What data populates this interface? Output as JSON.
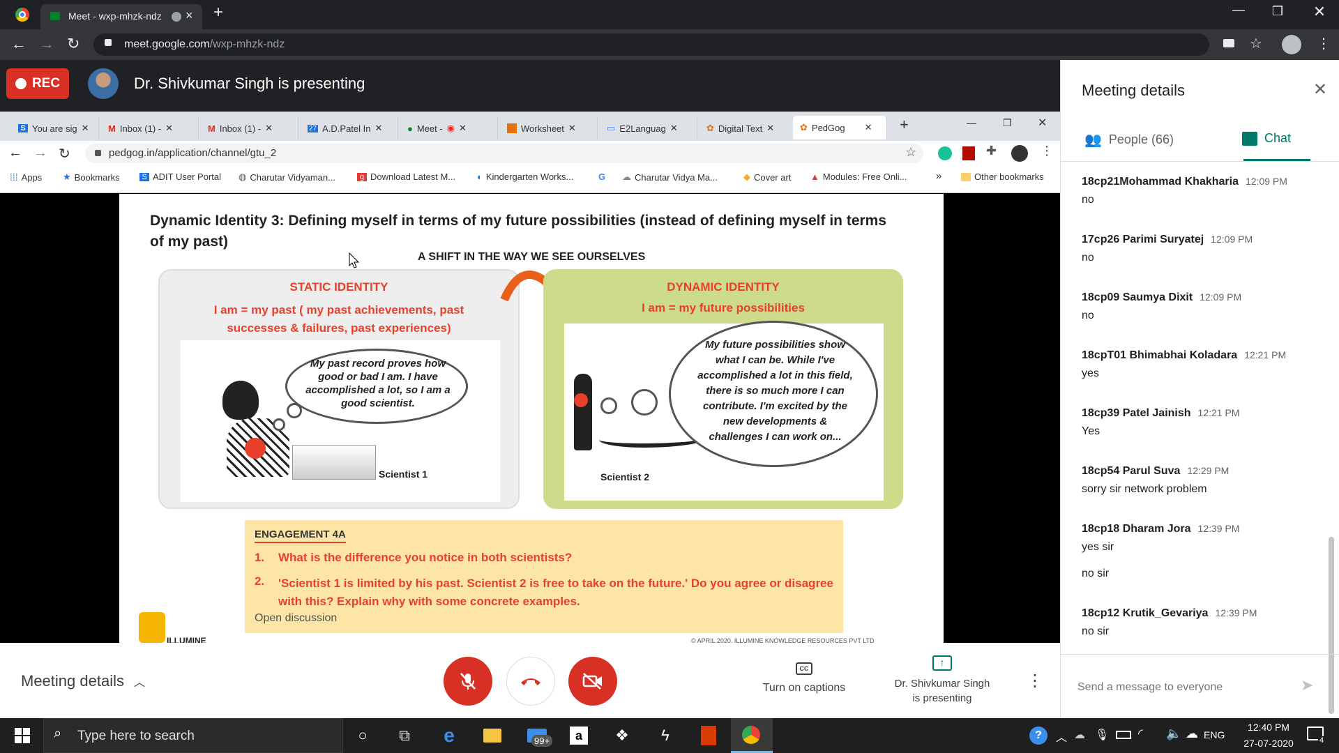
{
  "browser": {
    "tab_title": "Meet - wxp-mhzk-ndz",
    "url_host": "meet.google.com",
    "url_path": "/wxp-mhzk-ndz"
  },
  "meet": {
    "rec_label": "REC",
    "presenting_banner": "Dr. Shivkumar Singh is presenting"
  },
  "inner_browser": {
    "tabs": [
      "You are sig",
      "Inbox (1) -",
      "Inbox (1) -",
      "A.D.Patel In",
      "Meet -",
      "Worksheet",
      "E2Languag",
      "Digital Text",
      "PedGog"
    ],
    "url": "pedgog.in/application/channel/gtu_2",
    "bookmarks": [
      "Apps",
      "Bookmarks",
      "ADIT User Portal",
      "Charutar Vidyaman...",
      "Download Latest M...",
      "Kindergarten Works...",
      "Charutar Vidya Ma...",
      "Cover art",
      "Modules: Free Onli..."
    ],
    "bookmarks_more": "»",
    "other_bookmarks": "Other bookmarks"
  },
  "slide": {
    "title": "Dynamic Identity 3: Defining myself in terms of my future possibilities (instead of defining myself in terms of my past)",
    "subtitle": "A SHIFT IN THE WAY WE SEE OURSELVES",
    "static_heading": "STATIC IDENTITY",
    "static_desc": "I am = my past ( my past achievements, past successes & failures, past experiences)",
    "static_thought": "My past record proves how good or bad I am. I have accomplished a lot, so I am a good scientist.",
    "static_caption": "Scientist 1",
    "dynamic_heading": "DYNAMIC IDENTITY",
    "dynamic_desc": "I am = my future possibilities",
    "dynamic_thought": "My future possibilities show what I can be. While I've accomplished a lot in this field, there is so much more I can contribute. I'm excited by the new developments & challenges I can work on...",
    "dynamic_caption": "Scientist 2",
    "engagement_title": "ENGAGEMENT 4A",
    "q1_num": "1.",
    "q1": "What is the difference you notice in both scientists?",
    "q2_num": "2.",
    "q2": "'Scientist 1 is limited by his past. Scientist 2 is free to take on the future.' Do you agree or disagree with this? Explain why with some concrete examples.",
    "open_discussion": "Open discussion",
    "logo_text": "ILLUMINE",
    "footer": "© APRIL 2020, ILLUMINE KNOWLEDGE RESOURCES PVT LTD"
  },
  "controls": {
    "meeting_details": "Meeting details",
    "captions_label": "Turn on captions",
    "presenting_line1": "Dr. Shivkumar Singh",
    "presenting_line2": "is presenting"
  },
  "panel": {
    "title": "Meeting details",
    "people_tab": "People (66)",
    "chat_tab": "Chat",
    "messages": [
      {
        "name": "18cp21Mohammad Khakharia",
        "time": "12:09 PM",
        "text": "no"
      },
      {
        "name": "17cp26 Parimi Suryatej",
        "time": "12:09 PM",
        "text": "no"
      },
      {
        "name": "18cp09 Saumya Dixit",
        "time": "12:09 PM",
        "text": "no"
      },
      {
        "name": "18cpT01 Bhimabhai Koladara",
        "time": "12:21 PM",
        "text": "yes"
      },
      {
        "name": "18cp39 Patel Jainish",
        "time": "12:21 PM",
        "text": "Yes"
      },
      {
        "name": "18cp54 Parul Suva",
        "time": "12:29 PM",
        "text": "sorry sir network problem"
      },
      {
        "name": "18cp18 Dharam Jora",
        "time": "12:39 PM",
        "text": "yes sir",
        "text2": "no sir"
      },
      {
        "name": "18cp12 Krutik_Gevariya",
        "time": "12:39 PM",
        "text": "no sir"
      }
    ],
    "input_placeholder": "Send a message to everyone"
  },
  "taskbar": {
    "search_placeholder": "Type here to search",
    "mail_badge": "99+",
    "lang": "ENG",
    "time": "12:40 PM",
    "date": "27-07-2020",
    "notif_count": "4"
  },
  "colors": {
    "rec_red": "#d93025",
    "meet_teal": "#00796b",
    "slide_red": "#e8402a",
    "slide_green": "#cddc8a",
    "engagement_bg": "#fde4a7"
  }
}
